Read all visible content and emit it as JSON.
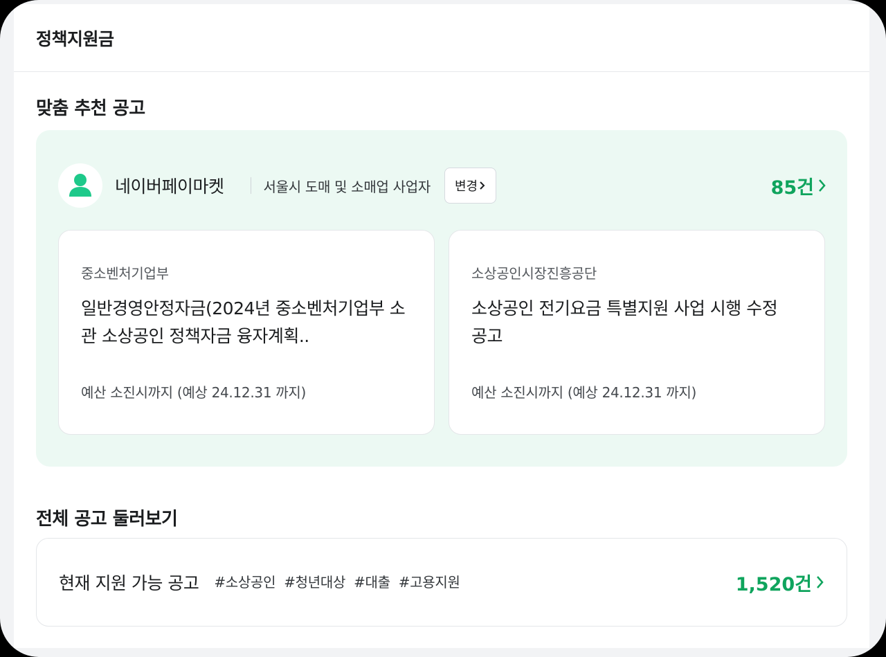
{
  "header": {
    "title": "정책지원금"
  },
  "recommended": {
    "section_title": "맞춤 추천 공고",
    "profile": {
      "avatar_icon": "user-icon",
      "business_name": "네이버페이마켓",
      "business_type": "서울시 도매 및 소매업 사업자",
      "change_label": "변경"
    },
    "count_label": "85건",
    "cards": [
      {
        "agency": "중소벤처기업부",
        "title": "일반경영안정자금(2024년 중소벤처기업부 소관 소상공인 정책자금 융자계획..",
        "period": "예산 소진시까지 (예상 24.12.31 까지)"
      },
      {
        "agency": "소상공인시장진흥공단",
        "title": "소상공인 전기요금 특별지원 사업 시행 수정 공고",
        "period": "예산 소진시까지 (예상 24.12.31 까지)"
      }
    ]
  },
  "browse": {
    "section_title": "전체 공고 둘러보기",
    "label": "현재 지원 가능 공고",
    "tags": [
      "#소상공인",
      "#청년대상",
      "#대출",
      "#고용지원"
    ],
    "count_label": "1,520건"
  },
  "colors": {
    "accent_green": "#0fa45d",
    "avatar_green": "#1ec98a",
    "recommend_bg": "#ecf9f3"
  }
}
